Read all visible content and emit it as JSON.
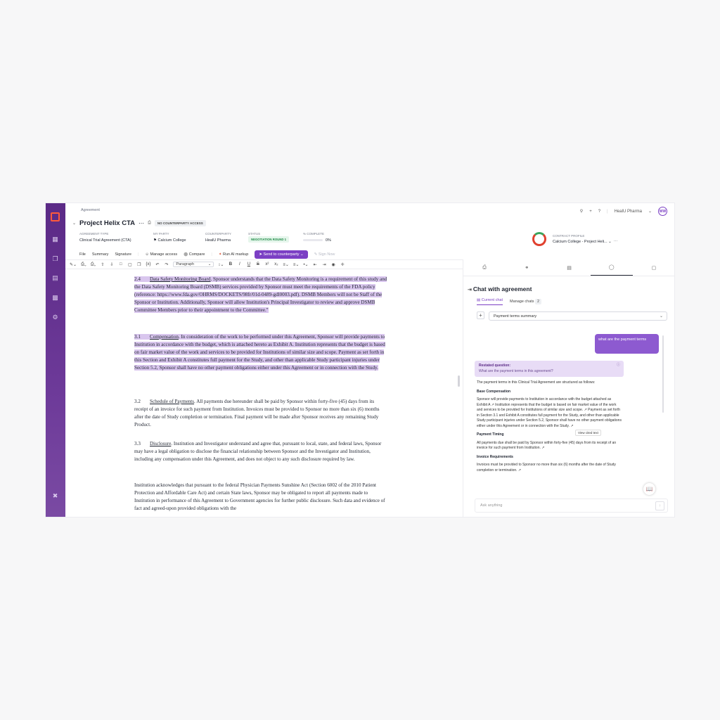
{
  "header": {
    "breadcrumb": "Agreement",
    "title": "Project Helix CTA",
    "access_badge": "NO COUNTERPARTY ACCESS",
    "org": "HealU Pharma",
    "avatar_initials": "WW"
  },
  "meta": {
    "agreement_type_label": "AGREEMENT TYPE",
    "agreement_type": "Clinical Trial Agreement (CTA)",
    "my_party_label": "MY PARTY",
    "my_party": "Calcium College",
    "counterparty_label": "COUNTERPARTY",
    "counterparty": "HealU Pharma",
    "status_label": "STATUS",
    "status": "NEGOTIATION ROUND 1",
    "complete_label": "% COMPLETE",
    "complete": "0%",
    "contract_profile_label": "CONTRACT PROFILE",
    "contract_profile": "Calcium College - Project Heli..."
  },
  "menu": {
    "file": "File",
    "summary": "Summary",
    "signature": "Signature",
    "manage_access": "Manage access",
    "compare": "Compare",
    "ai_markup": "Run AI markup",
    "send": "Send to counterparty",
    "sign_now": "Sign Now"
  },
  "toolbar": {
    "paragraph": "Paragraph"
  },
  "document": {
    "p1_num": "2.4",
    "p1_head": "Data Safety Monitoring Board",
    "p1_body": ".  Sponsor understands that the Data Safety Monitoring is a requirement of this study and the Data Safety Monitoring Board (DSMB) services provided by Sponsor must meet the requirements of the FDA policy (reference: https://www.fda.gov/OHRMS/DOCKETS/98fr/01d-0489-gdl0003.pdf).  DSMB Members will not be Staff of the Sponsor or Institution.  Additionally, Sponsor will allow Institution's Principal Investigator to review and approve DSMB Committee Members prior to their appointment to the Committee.\"",
    "p2_num": "3.1",
    "p2_head": "Compensation",
    "p2_body": ".  In consideration of the work to be performed under this Agreement, Sponsor will provide payments to Institution in accordance with the budget, which is attached hereto as Exhibit A.  Institution represents that the budget is based on fair market value of the work and services to be provided for Institutions of similar size and scope.  Payment as set forth in this Section and Exhibit A constitutes full payment for the Study, and other than applicable Study participant injuries under Section 5.2, Sponsor shall have no other payment obligations either under this Agreement or in connection with the Study.",
    "p3_num": "3.2",
    "p3_head": "Schedule of Payments",
    "p3_body": ".  All payments due hereunder shall be paid by Sponsor within forty-five (45) days from its receipt of an invoice for such payment from Institution.  Invoices must be provided to Sponsor no more than six (6) months after the date of Study completion or termination.  Final payment will be made after Sponsor receives any remaining Study Product.",
    "p4_num": "3.3",
    "p4_head": "Disclosure",
    "p4_body": ".      Institution and Investigator understand and agree that, pursuant to local, state, and federal laws, Sponsor may have a legal obligation to disclose the financial relationship between Sponsor and the Investigator and Institution, including any compensation under this Agreement, and does not object to any such disclosure required by law.",
    "p5_body": "Institution acknowledges that pursuant to the federal Physician Payments Sunshine Act (Section 6002 of the 2010 Patient Protection and Affordable Care Act) and certain State laws, Sponsor may be obligated to report all payments made to Institution in performance of this Agreement to Government agencies for further public disclosure.  Such data and evidence of fact and agreed-upon provided obligations with the"
  },
  "chat": {
    "title": "Chat with agreement",
    "current_chat": "Current chat",
    "manage_chats": "Manage chats",
    "chat_count": "2",
    "summary_select": "Payment terms summary",
    "user_message": "what are the payment terms",
    "restated_label": "Restated question:",
    "restated_question": "What are the payment terms in this agreement?",
    "intro": "The payment terms in this Clinical Trial Agreement are structured as follows:",
    "h1": "Base Compensation",
    "t1": "Sponsor will provide payments to Institution in accordance with the budget attached as Exhibit A ↗ Institution represents that the budget is based on fair market value of the work and services to be provided for Institutions of similar size and scope. ↗ Payment as set forth in Section 3.1 and Exhibit A constitutes full payment for the Study, and other than applicable Study participant injuries under Section 5.2, Sponsor shall have no other payment obligations either under this Agreement or in connection with the Study. ↗",
    "h2": "Payment Timing",
    "t2": "All payments due shall be paid by Sponsor within forty-five (45) days from its receipt of an invoice for such payment from Institution. ↗",
    "h3": "Invoice Requirements",
    "t3": "Invoices must be provided to Sponsor no more than six (6) months after the date of Study completion or termination. ↗",
    "tooltip": "View cited text",
    "ask_placeholder": "Ask anything"
  },
  "colors": {
    "brand_purple": "#7b3fc4",
    "highlight": "#d9c6ee",
    "rail": "#5b2a86"
  }
}
